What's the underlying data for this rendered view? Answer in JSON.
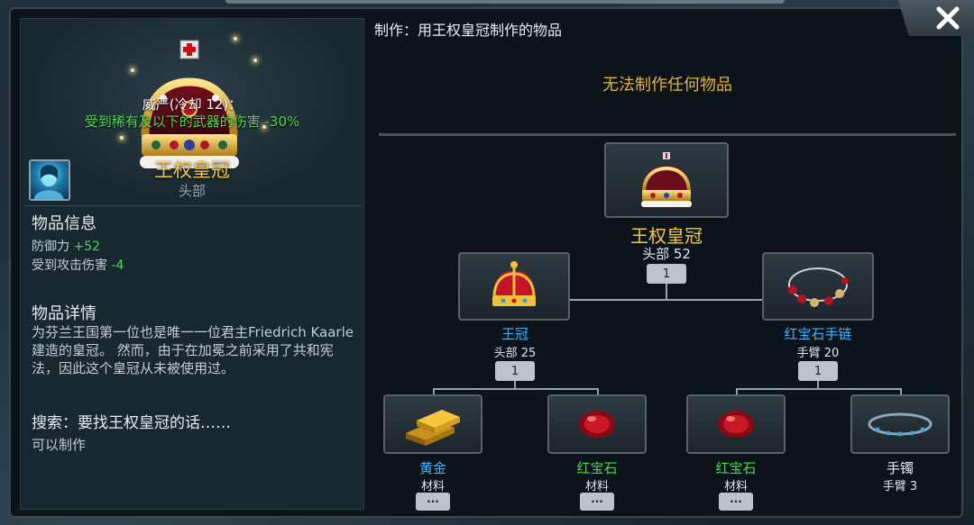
{
  "left": {
    "ability_title": "威严(冷却 12)：",
    "ability_desc": "受到稀有及以下的武器的伤害 -30%",
    "item_name": "王权皇冠",
    "item_slot": "头部",
    "info_title": "物品信息",
    "stats": [
      {
        "label": "防御力",
        "value": "+52"
      },
      {
        "label": "受到攻击伤害",
        "value": "-4"
      }
    ],
    "details_title": "物品详情",
    "details_text": "为芬兰王国第一位也是唯一一位君主Friedrich Kaarle建造的皇冠。 然而，由于在加冕之前采用了共和宪法，因此这个皇冠从未被使用过。",
    "search_title": "搜索：要找王权皇冠的话……",
    "search_result": "可以制作"
  },
  "craft": {
    "header": "制作：用王权皇冠制作的物品",
    "none": "无法制作任何物品"
  },
  "tree": {
    "root": {
      "name": "王权皇冠",
      "sub": "头部 52",
      "count": "1"
    },
    "left": {
      "name": "王冠",
      "sub": "头部 25",
      "count": "1"
    },
    "right": {
      "name": "红宝石手链",
      "sub": "手臂 20",
      "count": "1"
    },
    "leaves": [
      {
        "name": "黄金",
        "sub": "材料",
        "more": "···"
      },
      {
        "name": "红宝石",
        "sub": "材料",
        "more": "···"
      },
      {
        "name": "红宝石",
        "sub": "材料",
        "more": "···"
      },
      {
        "name": "手镯",
        "sub": "手臂 3"
      }
    ]
  },
  "colors": {
    "gold": "#f5c84a",
    "blue_item": "#3fb5ff",
    "green_item": "#3ee04a",
    "white_item": "#e8ecef",
    "bonus_green": "#4fd84f"
  },
  "icons": {
    "close": "close-icon",
    "crown": "crown-icon",
    "red_crown": "red-crown-icon",
    "ruby_bracelet": "ruby-bracelet-icon",
    "gold": "gold-bar-icon",
    "ruby": "ruby-icon",
    "bracelet": "bracelet-icon",
    "avatar": "character-avatar-icon"
  }
}
